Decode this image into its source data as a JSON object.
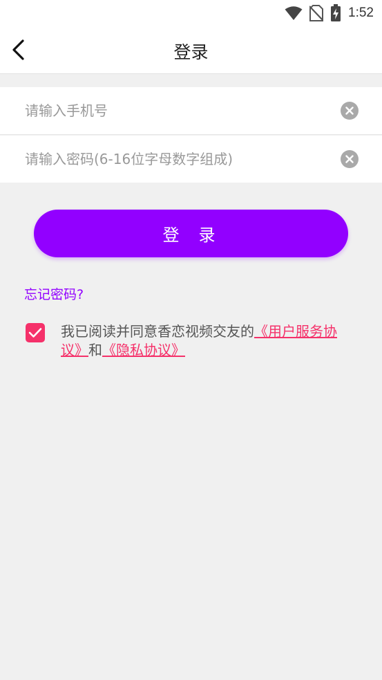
{
  "status_bar": {
    "time": "1:52",
    "icons": [
      "wifi-icon",
      "no-sim-icon",
      "battery-charging-icon"
    ]
  },
  "header": {
    "title": "登录",
    "back_icon": "chevron-left-icon"
  },
  "form": {
    "phone_placeholder": "请输入手机号",
    "password_placeholder": "请输入密码(6-16位字母数字组成)",
    "clear_icon": "clear-circle-icon"
  },
  "login_button": {
    "label": "登录"
  },
  "forgot_link": "忘记密码?",
  "agreement": {
    "checked": true,
    "text": "我已阅读并同意香恋视频交友的",
    "user_agreement": "《用户服务协议》",
    "and": "和",
    "privacy_policy": "《隐私协议》"
  },
  "colors": {
    "accent": "#9200ff",
    "link": "#f5316a",
    "background": "#f0f0f0"
  }
}
